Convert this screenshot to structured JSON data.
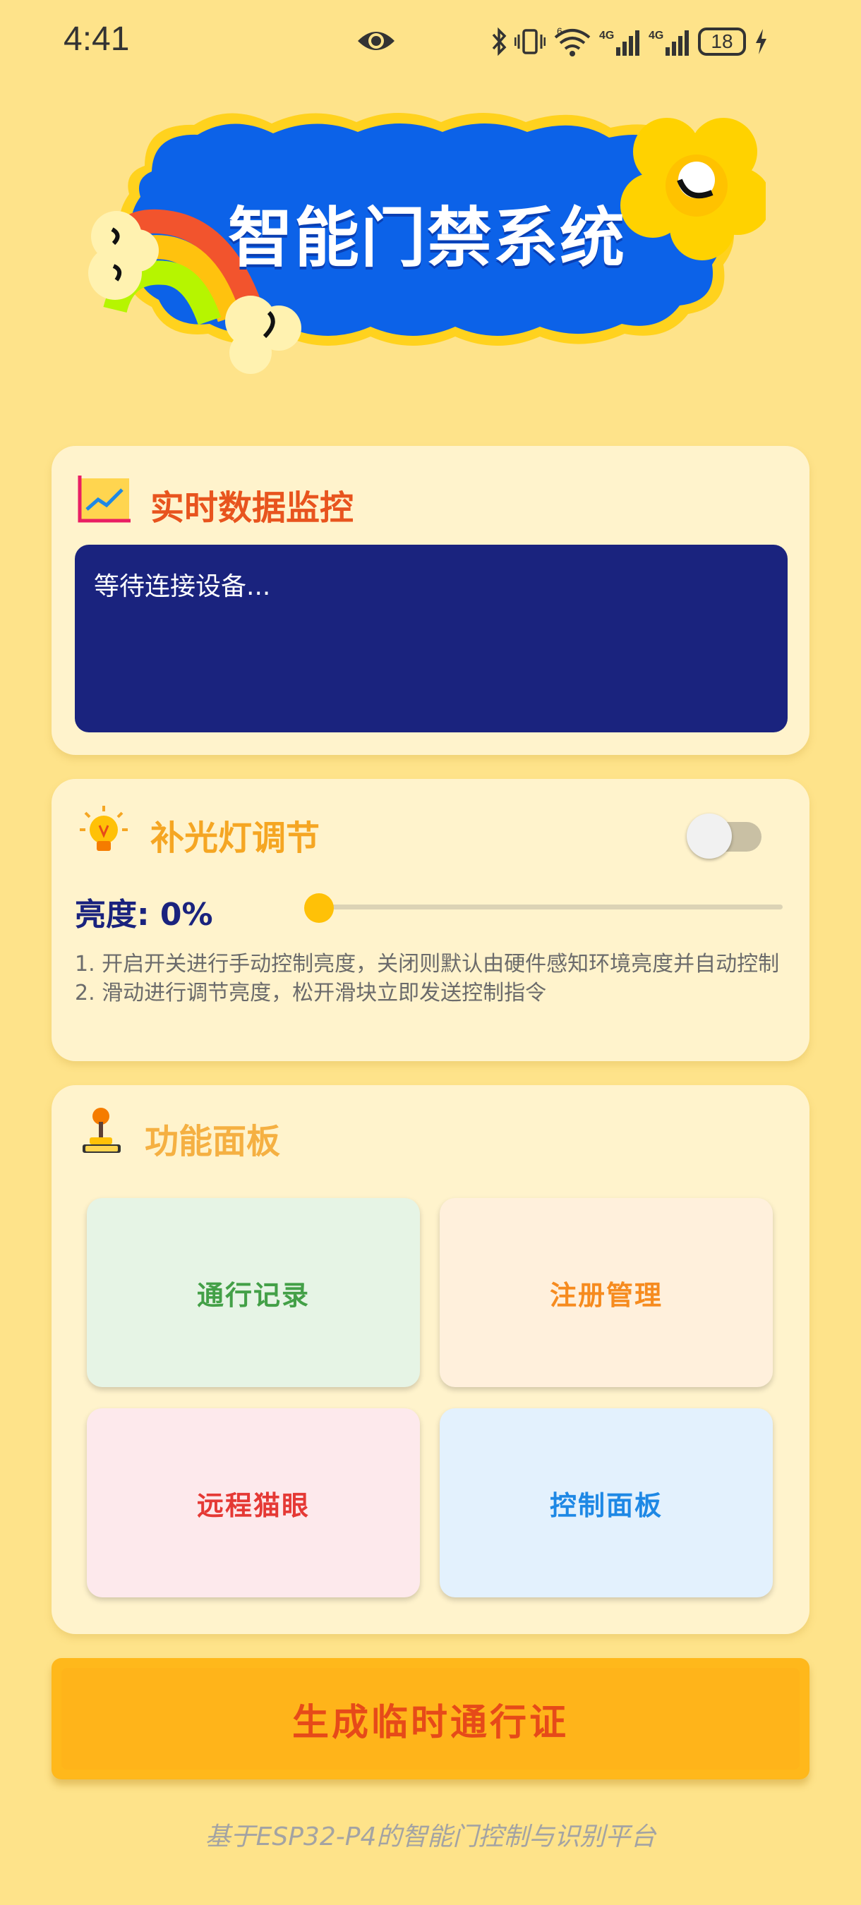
{
  "status_bar": {
    "time": "4:41",
    "battery": "18",
    "icons": [
      "eye-icon",
      "bluetooth-icon",
      "vibrate-icon",
      "wifi-icon",
      "signal-4g-icon",
      "signal-4g-icon",
      "battery-icon",
      "charging-icon"
    ]
  },
  "banner": {
    "title": "智能门禁系统"
  },
  "monitor": {
    "title": "实时数据监控",
    "icon": "chart-icon",
    "status_text": "等待连接设备..."
  },
  "light": {
    "title": "补光灯调节",
    "icon": "lightbulb-icon",
    "toggle_on": false,
    "brightness_label": "亮度: 0%",
    "brightness_value": 0,
    "note_1": "1. 开启开关进行手动控制亮度，关闭则默认由硬件感知环境亮度并自动控制",
    "note_2": "2. 滑动进行调节亮度，松开滑块立即发送控制指令"
  },
  "functions": {
    "title": "功能面板",
    "icon": "joystick-icon",
    "buttons": [
      {
        "label": "通行记录",
        "color": "#43A047"
      },
      {
        "label": "注册管理",
        "color": "#F68B1F"
      },
      {
        "label": "远程猫眼",
        "color": "#E53935"
      },
      {
        "label": "控制面板",
        "color": "#1E88E5"
      }
    ]
  },
  "pass_button": {
    "label": "生成临时通行证"
  },
  "footer": {
    "text": "基于ESP32-P4的智能门控制与识别平台"
  },
  "colors": {
    "background": "#FEE38A",
    "card": "#FFF3CC",
    "monitor_screen": "#1A237E",
    "accent_orange": "#FFB81B",
    "banner_blue": "#0C62E8"
  }
}
